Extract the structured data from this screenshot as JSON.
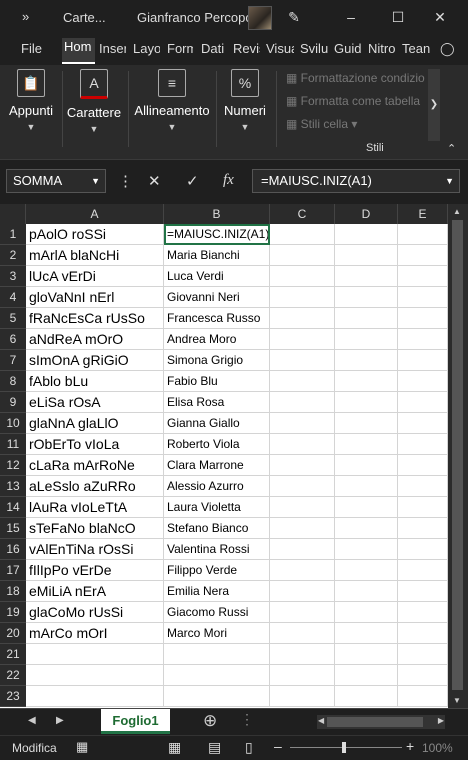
{
  "titlebar": {
    "file_name": "Carte...",
    "user": "Gianfranco Percopo",
    "qa_icon": "chevron-double-right"
  },
  "tabs": [
    "File",
    "Hom",
    "Inser",
    "Layo",
    "Form",
    "Dati",
    "Revis",
    "Visua",
    "Svilu",
    "Guid",
    "Nitro",
    "Tean"
  ],
  "ribbon": {
    "groups": [
      "Appunti",
      "Carattere",
      "Allineamento",
      "Numeri"
    ],
    "styles": [
      "Formattazione condizio",
      "Formatta come tabella",
      "Stili cella"
    ],
    "styles_label": "Stili"
  },
  "formula_bar": {
    "name_box": "SOMMA",
    "formula": "=MAIUSC.INIZ(A1)",
    "fx_label": "fx"
  },
  "columns": [
    "A",
    "B",
    "C",
    "D",
    "E"
  ],
  "rows": [
    {
      "n": "1",
      "a": "pAolO roSSi",
      "b": "=MAIUSC.INIZ(A1)"
    },
    {
      "n": "2",
      "a": "mArlA blaNcHi",
      "b": "Maria Bianchi"
    },
    {
      "n": "3",
      "a": "lUcA vErDi",
      "b": "Luca Verdi"
    },
    {
      "n": "4",
      "a": "gloVaNnI nErl",
      "b": "Giovanni Neri"
    },
    {
      "n": "5",
      "a": "fRaNcEsCa rUsSo",
      "b": "Francesca Russo"
    },
    {
      "n": "6",
      "a": "aNdReA mOrO",
      "b": "Andrea Moro"
    },
    {
      "n": "7",
      "a": "sImOnA gRiGiO",
      "b": "Simona Grigio"
    },
    {
      "n": "8",
      "a": "fAblo bLu",
      "b": "Fabio Blu"
    },
    {
      "n": "9",
      "a": "eLiSa rOsA",
      "b": "Elisa Rosa"
    },
    {
      "n": "10",
      "a": "glaNnA glaLlO",
      "b": "Gianna Giallo"
    },
    {
      "n": "11",
      "a": "rObErTo vIoLa",
      "b": "Roberto Viola"
    },
    {
      "n": "12",
      "a": "cLaRa mArRoNe",
      "b": "Clara Marrone"
    },
    {
      "n": "13",
      "a": "aLeSslo aZuRRo",
      "b": "Alessio Azurro"
    },
    {
      "n": "14",
      "a": "lAuRa vIoLeTtA",
      "b": "Laura Violetta"
    },
    {
      "n": "15",
      "a": "sTeFaNo blaNcO",
      "b": "Stefano Bianco"
    },
    {
      "n": "16",
      "a": "vAlEnTiNa rOsSi",
      "b": "Valentina Rossi"
    },
    {
      "n": "17",
      "a": "fIlIpPo vErDe",
      "b": "Filippo Verde"
    },
    {
      "n": "18",
      "a": "eMiLiA nErA",
      "b": "Emilia Nera"
    },
    {
      "n": "19",
      "a": "glaCoMo rUsSi",
      "b": "Giacomo Russi"
    },
    {
      "n": "20",
      "a": "mArCo mOrI",
      "b": "Marco Mori"
    },
    {
      "n": "21",
      "a": "",
      "b": ""
    },
    {
      "n": "22",
      "a": "",
      "b": ""
    },
    {
      "n": "23",
      "a": "",
      "b": ""
    }
  ],
  "sheet_tab": "Foglio1",
  "status": {
    "mode": "Modifica",
    "zoom": "100%"
  }
}
